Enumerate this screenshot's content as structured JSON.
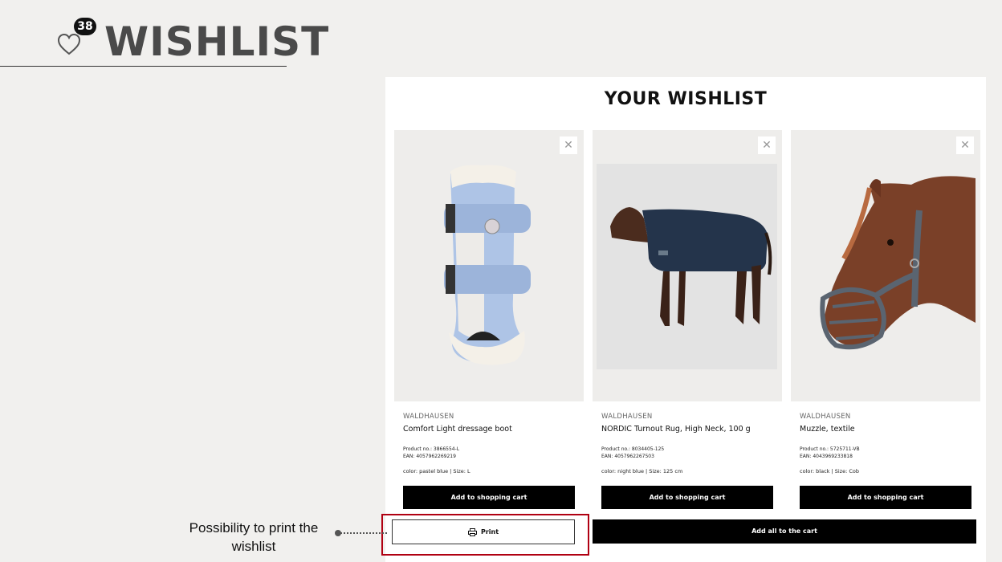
{
  "slide": {
    "title": "WISHLIST",
    "badge_count": "38",
    "callout": "Possibility to print the wishlist"
  },
  "wishlist": {
    "title": "YOUR WISHLIST",
    "remove_icon": "close-icon",
    "items": [
      {
        "brand": "WALDHAUSEN",
        "name": "Comfort Light dressage boot",
        "product_no": "Product no.: 3866554-L",
        "ean": "EAN: 4057962269219",
        "attrs": "color: pastel blue | Size: L",
        "add_label": "Add to shopping cart"
      },
      {
        "brand": "WALDHAUSEN",
        "name": "NORDIC Turnout Rug, High Neck, 100 g",
        "product_no": "Product no.: 8034405-125",
        "ean": "EAN: 4057962267503",
        "attrs": "color: night blue | Size: 125 cm",
        "add_label": "Add to shopping cart"
      },
      {
        "brand": "WALDHAUSEN",
        "name": "Muzzle, textile",
        "product_no": "Product no.: 5725711-VB",
        "ean": "EAN: 4043969233818",
        "attrs": "color: black | Size: Cob",
        "add_label": "Add to shopping cart"
      }
    ],
    "print_label": "Print",
    "add_all_label": "Add all to the cart"
  },
  "colors": {
    "slide_background": "#f1f0ee",
    "highlight": "#b00012",
    "button": "#000000"
  }
}
